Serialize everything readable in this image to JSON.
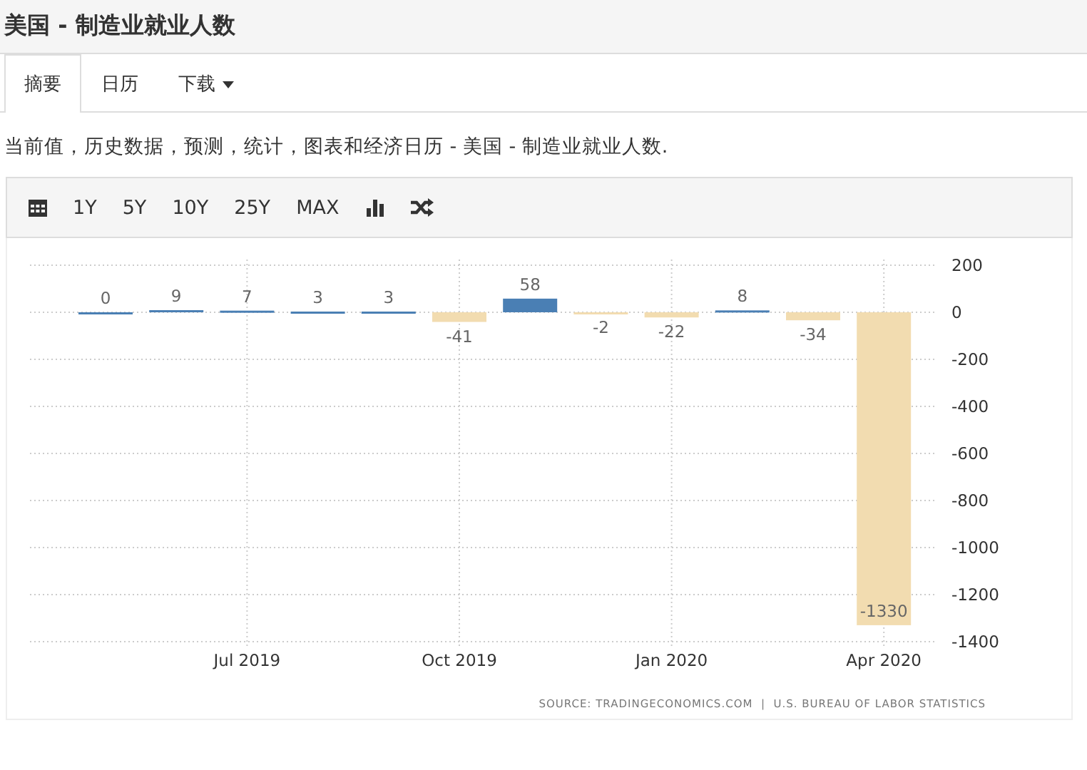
{
  "title": "美国 - 制造业就业人数",
  "tabs": [
    {
      "label": "摘要",
      "selected": true,
      "dropdown": false
    },
    {
      "label": "日历",
      "selected": false,
      "dropdown": false
    },
    {
      "label": "下载",
      "selected": false,
      "dropdown": true
    }
  ],
  "description": "当前值，历史数据，预测，统计，图表和经济日历 - 美国 - 制造业就业人数.",
  "toolbar": [
    {
      "kind": "calendar"
    },
    {
      "kind": "range",
      "label": "1Y"
    },
    {
      "kind": "range",
      "label": "5Y"
    },
    {
      "kind": "range",
      "label": "10Y"
    },
    {
      "kind": "range",
      "label": "25Y"
    },
    {
      "kind": "range",
      "label": "MAX"
    },
    {
      "kind": "chart-type"
    },
    {
      "kind": "compare"
    }
  ],
  "chart": {
    "chart_data": {
      "type": "bar",
      "values": [
        0,
        9,
        7,
        3,
        3,
        -41,
        58,
        -2,
        -22,
        8,
        -34,
        -1330
      ],
      "categories": [
        null,
        null,
        "Jul 2019",
        null,
        null,
        "Oct 2019",
        null,
        null,
        "Jan 2020",
        null,
        null,
        "Apr 2020"
      ],
      "grid": true,
      "ylim": [
        -1400,
        200
      ],
      "yticks": [
        200,
        0,
        -200,
        -400,
        -600,
        -800,
        -1000,
        -1200,
        -1400
      ],
      "data_labels": true
    },
    "source": "SOURCE: TRADINGECONOMICS.COM  |  U.S. BUREAU OF LABOR STATISTICS"
  }
}
